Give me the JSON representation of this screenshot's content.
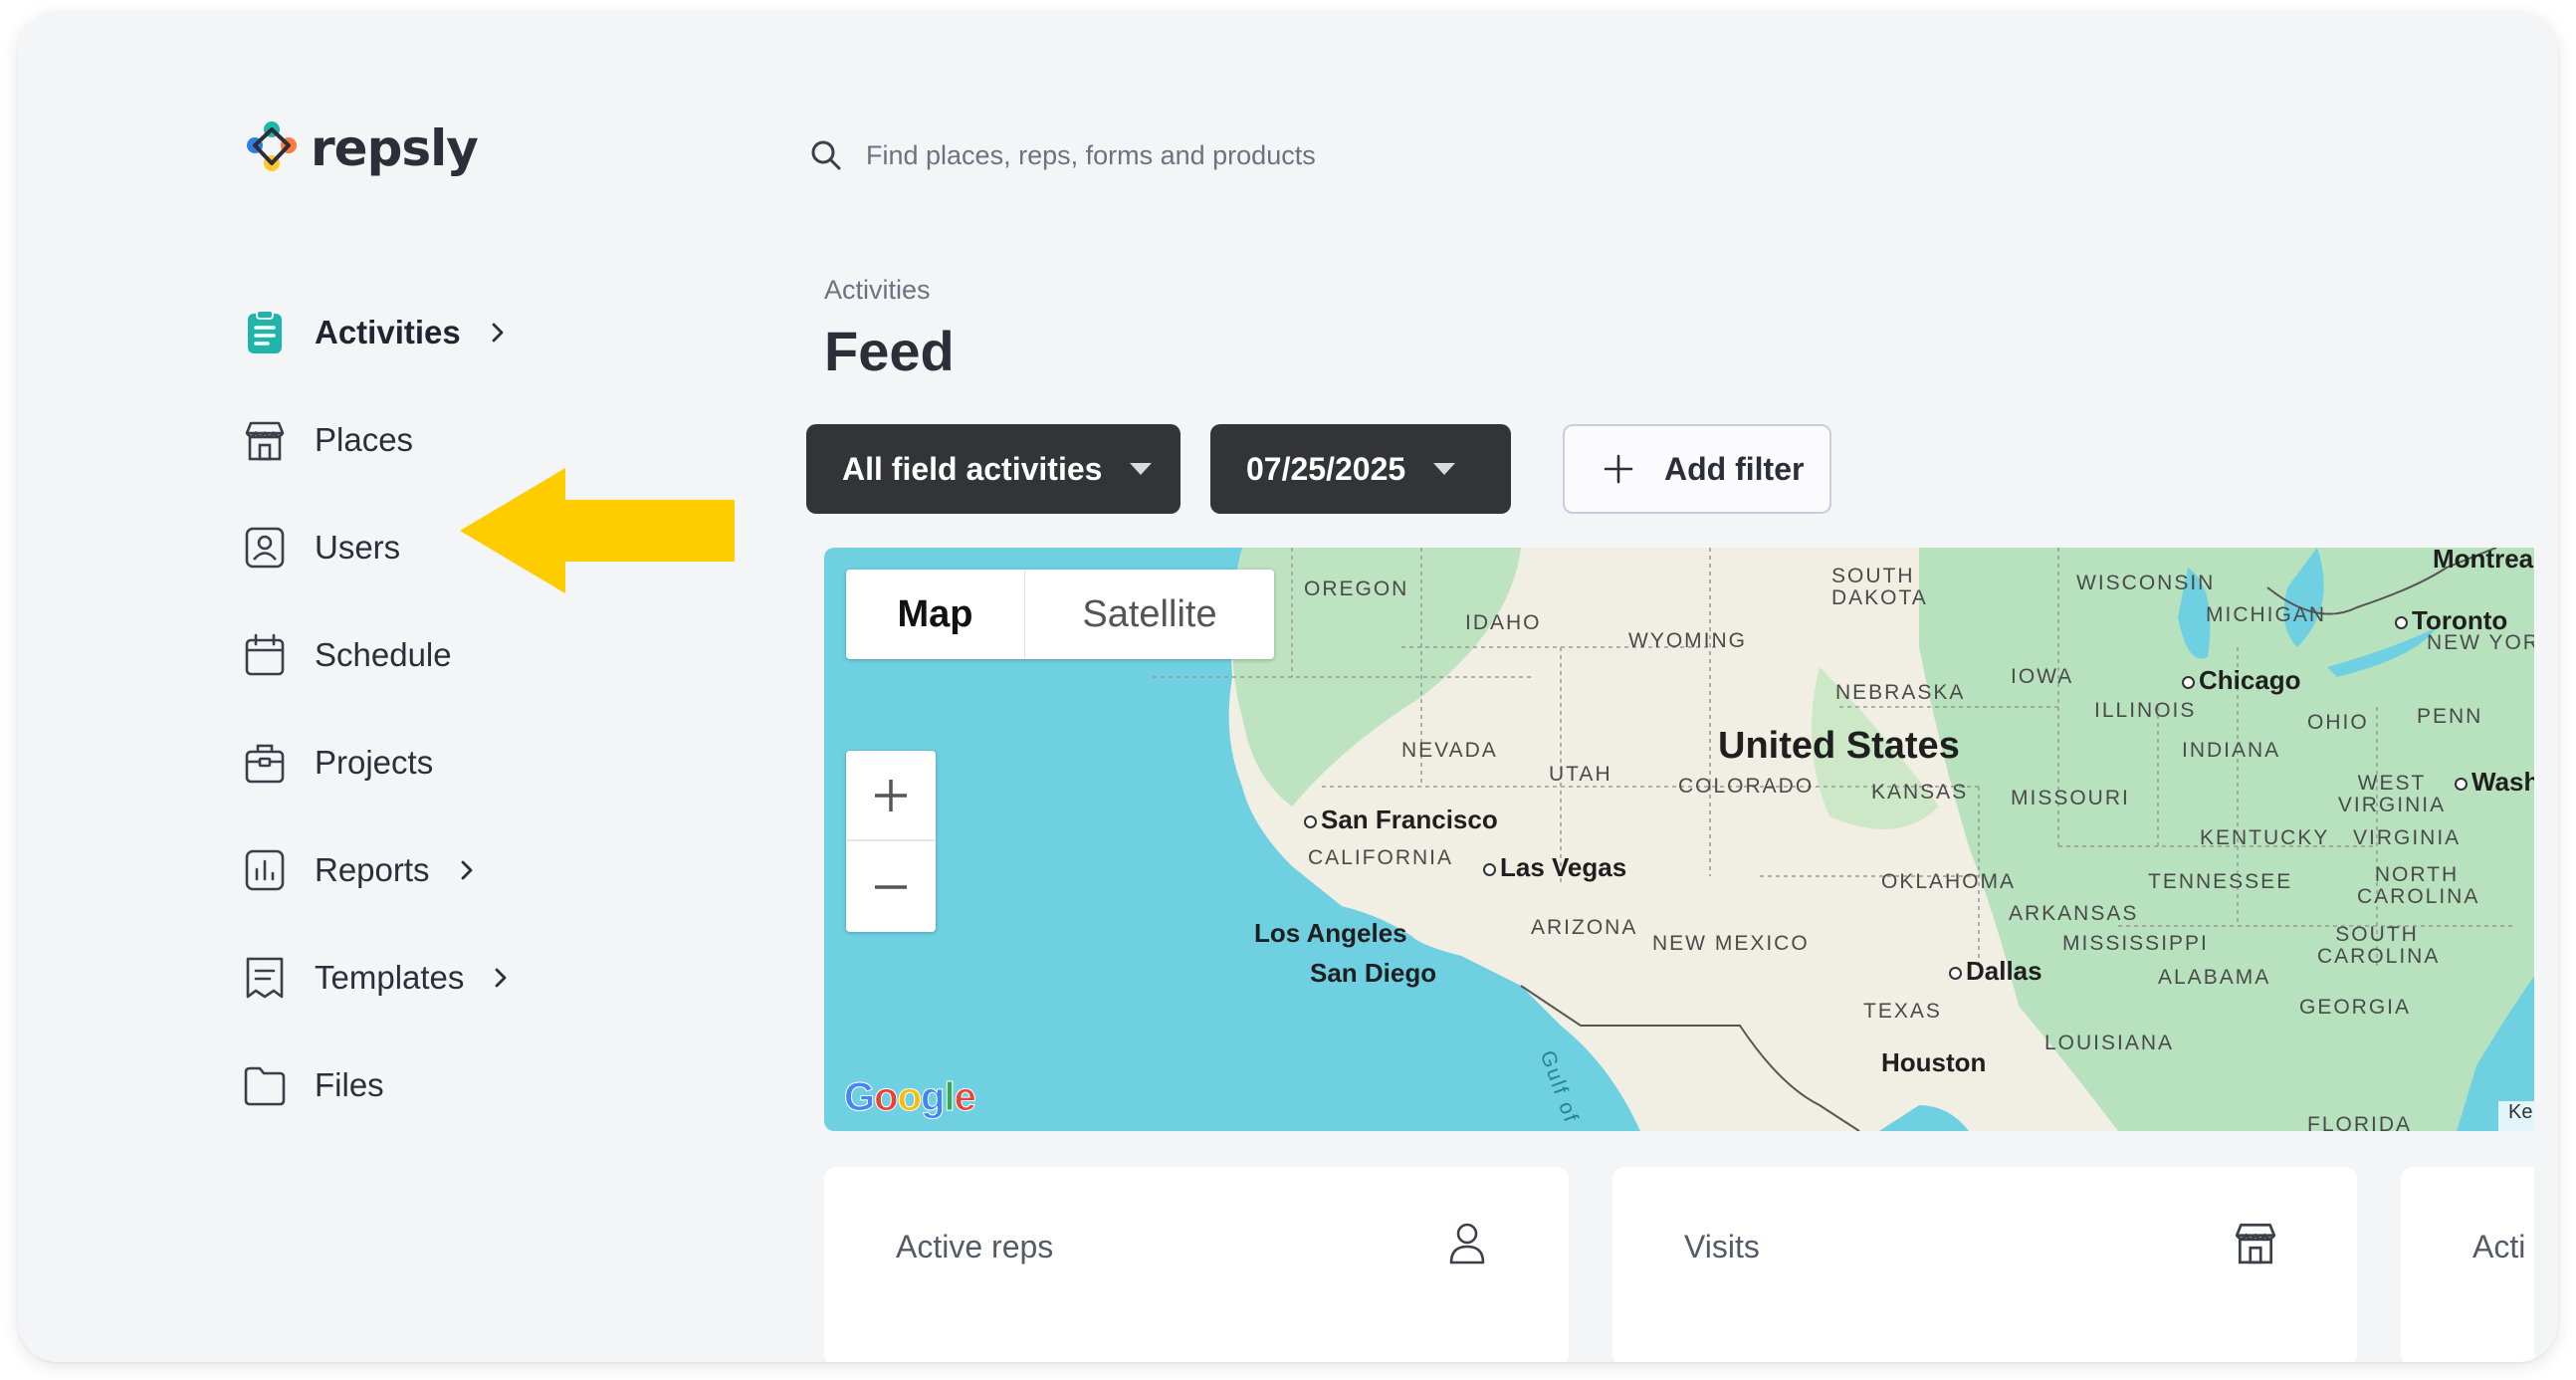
{
  "app": {
    "logo_text": "repsly"
  },
  "search": {
    "placeholder": "Find places, reps, forms and products",
    "icon": "search-icon"
  },
  "sidebar": {
    "items": [
      {
        "label": "Activities",
        "icon": "clipboard-icon",
        "active": true,
        "has_chevron": true
      },
      {
        "label": "Places",
        "icon": "store-icon",
        "active": false,
        "has_chevron": false
      },
      {
        "label": "Users",
        "icon": "user-badge-icon",
        "active": false,
        "has_chevron": false
      },
      {
        "label": "Schedule",
        "icon": "calendar-icon",
        "active": false,
        "has_chevron": false
      },
      {
        "label": "Projects",
        "icon": "briefcase-icon",
        "active": false,
        "has_chevron": false
      },
      {
        "label": "Reports",
        "icon": "bar-chart-icon",
        "active": false,
        "has_chevron": true
      },
      {
        "label": "Templates",
        "icon": "template-icon",
        "active": false,
        "has_chevron": true
      },
      {
        "label": "Files",
        "icon": "folder-icon",
        "active": false,
        "has_chevron": false
      }
    ]
  },
  "annotation": {
    "color": "#ffcc00",
    "points_to": "Users"
  },
  "page": {
    "breadcrumb": "Activities",
    "title": "Feed"
  },
  "filters": {
    "activity_type": "All field activities",
    "date": "07/25/2025",
    "add_filter": "Add filter"
  },
  "map": {
    "toggle_map": "Map",
    "toggle_satellite": "Satellite",
    "country": "United States",
    "states": [
      "OREGON",
      "IDAHO",
      "WYOMING",
      "SOUTH DAKOTA",
      "NEBRASKA",
      "IOWA",
      "WISCONSIN",
      "MICHIGAN",
      "ILLINOIS",
      "INDIANA",
      "OHIO",
      "PENN",
      "NEVADA",
      "UTAH",
      "COLORADO",
      "KANSAS",
      "MISSOURI",
      "KENTUCKY",
      "WEST VIRGINIA",
      "VIRGINIA",
      "CALIFORNIA",
      "ARIZONA",
      "NEW MEXICO",
      "OKLAHOMA",
      "ARKANSAS",
      "TENNESSEE",
      "NORTH CAROLINA",
      "SOUTH CAROLINA",
      "MISSISSIPPI",
      "ALABAMA",
      "GEORGIA",
      "TEXAS",
      "LOUISIANA",
      "FLORIDA",
      "NEW YORK"
    ],
    "cities": [
      "San Francisco",
      "Las Vegas",
      "Los Angeles",
      "San Diego",
      "Chicago",
      "Toronto",
      "Montreal",
      "Dallas",
      "Houston",
      "Wash"
    ],
    "water": "Gulf of",
    "attribution": "Google",
    "keys_label": "Ke"
  },
  "stats": [
    {
      "label": "Active reps",
      "icon": "person-icon"
    },
    {
      "label": "Visits",
      "icon": "store-icon"
    },
    {
      "label": "Acti",
      "icon": ""
    }
  ],
  "colors": {
    "accent": "#1fb5a8",
    "dark_button": "#323438",
    "background": "#f4f5f7"
  }
}
